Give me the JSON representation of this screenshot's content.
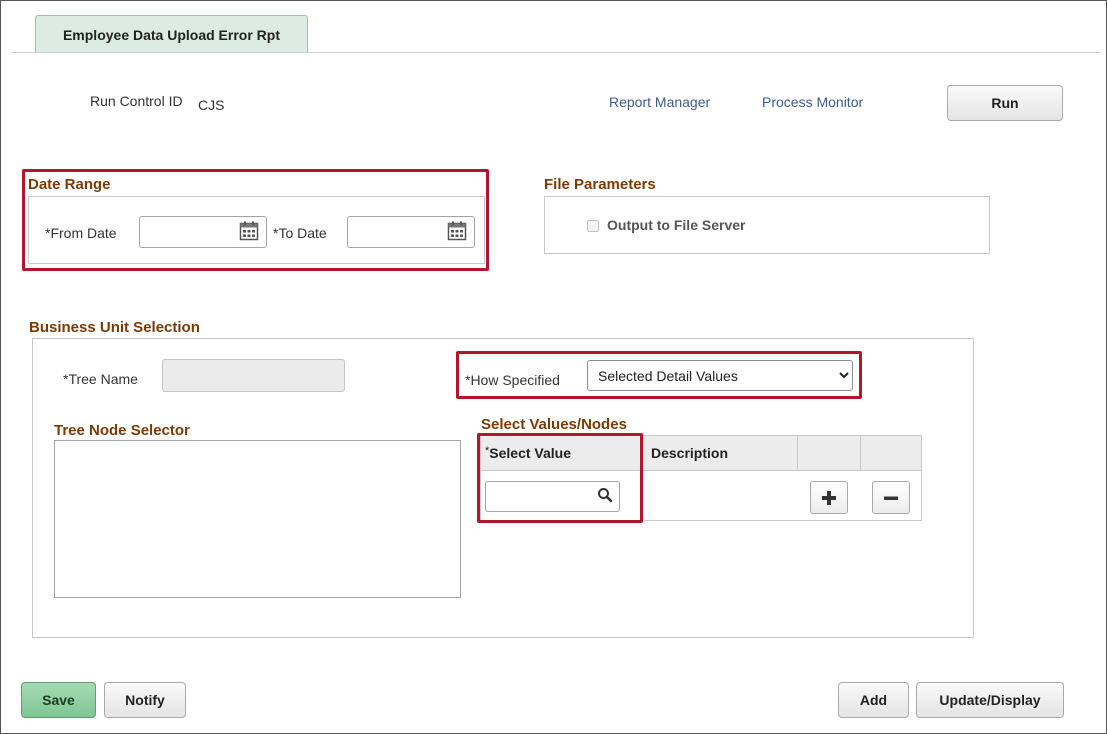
{
  "tab": {
    "label": "Employee Data Upload Error Rpt"
  },
  "header": {
    "run_control_label": "Run Control ID",
    "run_control_value": "CJS",
    "report_manager_link": "Report Manager",
    "process_monitor_link": "Process Monitor",
    "run_button": "Run"
  },
  "date_range": {
    "title": "Date Range",
    "from_label": "*From Date",
    "from_value": "",
    "to_label": "*To Date",
    "to_value": ""
  },
  "file_parameters": {
    "title": "File Parameters",
    "output_checkbox_label": "Output to File Server",
    "output_checked": false
  },
  "business_unit": {
    "title": "Business Unit Selection",
    "tree_name_label": "*Tree Name",
    "tree_name_value": "",
    "how_specified_label": "*How Specified",
    "how_specified_value": "Selected Detail Values",
    "tree_node_selector_title": "Tree Node Selector",
    "select_values_title": "Select Values/Nodes",
    "grid_columns": [
      "Select Value",
      "Description"
    ],
    "select_value_required_mark": "*",
    "select_value_input": ""
  },
  "footer": {
    "save_button": "Save",
    "notify_button": "Notify",
    "add_button": "Add",
    "update_display_button": "Update/Display"
  },
  "colors": {
    "accent_red": "#b4152c",
    "section_title": "#7a3b06",
    "link": "#3d5b8c",
    "save_green": "#7fc692"
  }
}
